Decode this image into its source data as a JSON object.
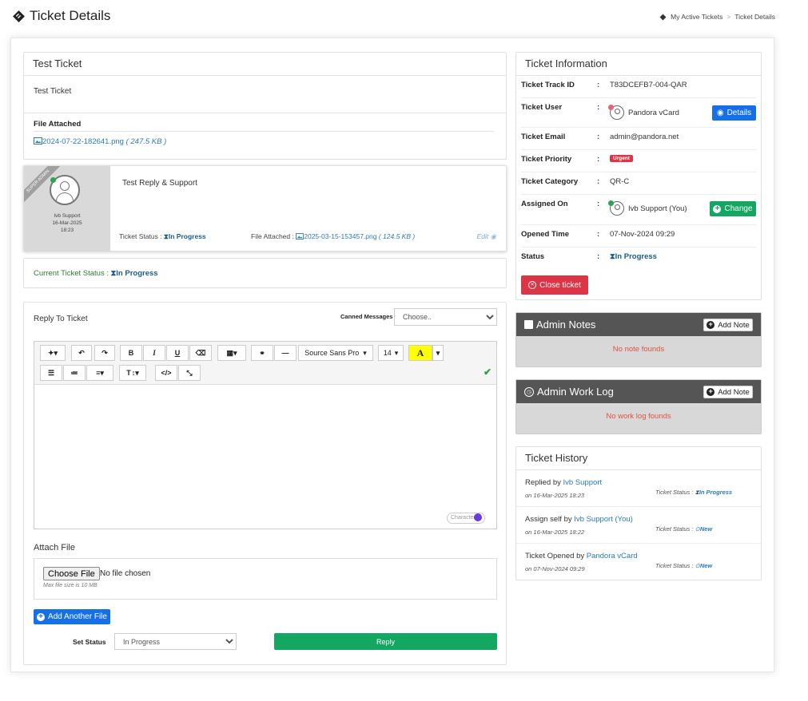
{
  "page": {
    "title": "Ticket Details",
    "breadcrumb": [
      "My Active Tickets",
      "Ticket Details"
    ]
  },
  "ticket": {
    "subject": "Test Ticket",
    "body": "Test Ticket",
    "file_attached_label": "File Attached",
    "file_name": "2024-07-22-182641.png",
    "file_size": "( 247.5 KB )"
  },
  "reply": {
    "ribbon": "SUPER ADMIN",
    "author": "Ivb Support",
    "date": "16-Mar-2025",
    "time": "18:23",
    "message": "Test Reply & Support",
    "status_label": "Ticket Status :",
    "status_value": "In Progress",
    "file_label": "File Attached :",
    "file_name": "2025-03-15-153457.png",
    "file_size": "( 124.5 KB )",
    "edit": "Edit"
  },
  "current_status": {
    "label": "Current Ticket Status :",
    "value": "In Progress"
  },
  "reply_form": {
    "title": "Reply To Ticket",
    "canned_label": "Canned Messages",
    "canned_value": "Choose..",
    "toolbar": {
      "font": "Source Sans Pro",
      "size": "14",
      "bold": "B",
      "italic": "I",
      "underline": "U",
      "highlight": "A",
      "textsize": "T",
      "code": "</>"
    },
    "char_label": "Character",
    "attach_title": "Attach File",
    "choose_file": "Choose File",
    "no_file": "No file chosen",
    "max_size": "Max file size is 10 MB",
    "add_file": "Add Another File",
    "set_status_label": "Set Status",
    "set_status_value": "In Progress",
    "submit": "Reply"
  },
  "info": {
    "title": "Ticket Information",
    "rows": [
      {
        "key": "Ticket Track ID",
        "value": "T83DCEFB7-004-QAR"
      },
      {
        "key": "Ticket User",
        "value": "Pandora vCard"
      },
      {
        "key": "Ticket Email",
        "value": "admin@pandora.net"
      },
      {
        "key": "Ticket Priority",
        "value": "Urgent"
      },
      {
        "key": "Ticket Category",
        "value": "QR-C"
      },
      {
        "key": "Assigned On",
        "value": "Ivb Support (You)"
      },
      {
        "key": "Opened Time",
        "value": "07-Nov-2024 09:29"
      },
      {
        "key": "Status",
        "value": "In Progress"
      }
    ],
    "colon": ":",
    "details_btn": "Details",
    "change_btn": "Change",
    "close_btn": "Close ticket"
  },
  "notes": {
    "title": "Admin Notes",
    "add": "Add Note",
    "empty": "No note founds"
  },
  "worklog": {
    "title": "Admin Work Log",
    "add": "Add Note",
    "empty": "No work log founds"
  },
  "history": {
    "title": "Ticket History",
    "items": [
      {
        "action": "Replied by",
        "who": "Ivb Support",
        "date": "on 16-Mar-2025 18:23",
        "status_label": "Ticket Status :",
        "status": "In Progress"
      },
      {
        "action": "Assign self by",
        "who": "Ivb Support (You)",
        "date": "on 16-Mar-2025 18:22",
        "status_label": "Ticket Status :",
        "status": "New"
      },
      {
        "action": "Ticket Opened by",
        "who": "Pandora vCard",
        "date": "on 07-Nov-2024 09:29",
        "status_label": "Ticket Status :",
        "status": "New"
      }
    ]
  },
  "colors": {
    "primary": "#1570e8",
    "success": "#14a762",
    "danger": "#dc3545",
    "link": "#2a7ab8",
    "dark_header": "#555555",
    "empty_text": "#e0533f"
  }
}
